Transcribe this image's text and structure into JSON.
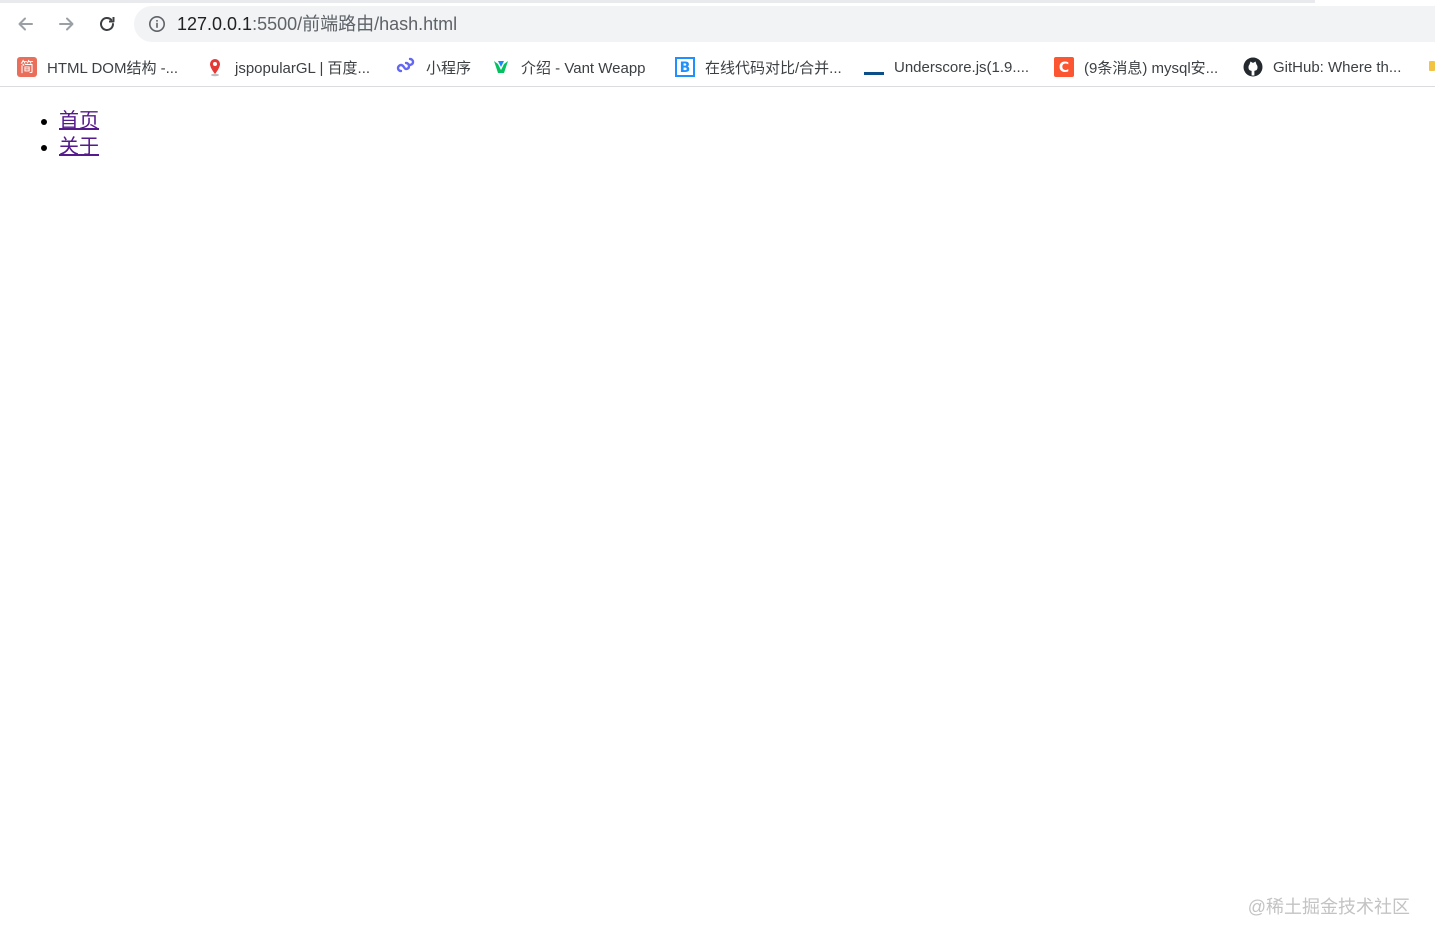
{
  "browser": {
    "address_host": "127.0.0.1",
    "address_path": ":5500/前端路由/hash.html",
    "nav_icons": [
      "back-arrow-icon",
      "forward-arrow-icon",
      "reload-icon",
      "site-info-icon"
    ]
  },
  "bookmarks": [
    {
      "label": "HTML DOM结构 -...",
      "icon_text": "简",
      "icon": "jianshu-icon",
      "color": "#ea6f5a"
    },
    {
      "label": "jspopularGL | 百度...",
      "icon": "map-pin-icon",
      "color": "#e53935"
    },
    {
      "label": "小程序",
      "icon": "miniprogram-link-icon",
      "color": "#6467f0"
    },
    {
      "label": "介绍 - Vant Weapp",
      "icon": "vant-icon",
      "color": "#07c160"
    },
    {
      "label": "在线代码对比/合并...",
      "icon_text": "B",
      "icon": "bejson-icon",
      "color": "#1e90ff"
    },
    {
      "label": "Underscore.js(1.9....",
      "icon": "underscore-icon",
      "color": "#0b4f8a"
    },
    {
      "label": "(9条消息) mysql安...",
      "icon_text": "C",
      "icon": "csdn-icon",
      "color": "#fc5531"
    },
    {
      "label": "GitHub: Where th...",
      "icon": "github-icon",
      "color": "#24292f"
    }
  ],
  "page": {
    "links": [
      {
        "label": "首页"
      },
      {
        "label": "关于"
      }
    ],
    "link_color": "#551a8b"
  },
  "watermark": "@稀土掘金技术社区"
}
